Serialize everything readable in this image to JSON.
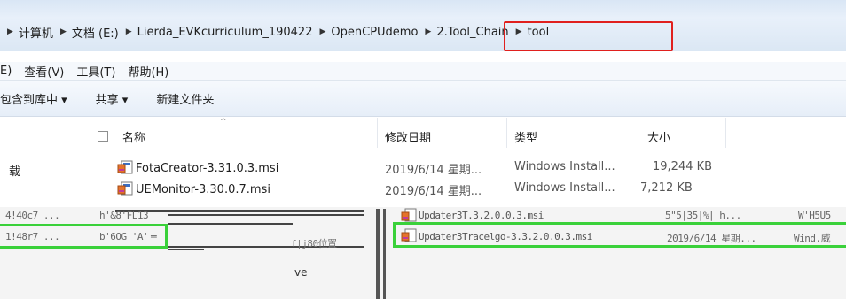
{
  "address_bar": {
    "crumbs": [
      "计算机",
      "文档 (E:)",
      "Lierda_EVKcurriculum_190422",
      "OpenCPUdemo",
      "2.Tool_Chain",
      "tool"
    ]
  },
  "menu": {
    "items": [
      "E)",
      "查看(V)",
      "工具(T)",
      "帮助(H)"
    ]
  },
  "toolbar": {
    "include_library": "包含到库中 ▾",
    "share": "共享 ▾",
    "new_folder": "新建文件夹"
  },
  "nav": {
    "item_download": "载"
  },
  "columns": {
    "name": "名称",
    "modified": "修改日期",
    "type": "类型",
    "size": "大小"
  },
  "files": [
    {
      "name": "FotaCreator-3.31.0.3.msi",
      "modified": "2019/6/14 星期...",
      "type": "Windows Install...",
      "size": "19,244 KB"
    },
    {
      "name": "UEMonitor-3.30.0.7.msi",
      "modified": "2019/6/14 星期...",
      "type": "Windows Install...",
      "size": "7,212 KB"
    }
  ],
  "glitch": {
    "text_ve": "ve",
    "left_row1_a": "4!40c7 ...",
    "left_row1_b": "h'&8'FL13",
    "left_row2_a": "1!48r7 ...",
    "left_row2_b": "b'6OG 'A'",
    "mid_label": "f|j80位置",
    "right_row1": "Updater3T.3.2.0.0.3.msi",
    "right_row1_tail": "5\"5|35|%| h...",
    "right_row1_end": "W'H5U5",
    "right_row2": "Updater3Tracelgo-3.3.2.0.0.3.msi",
    "right_row2_mid": "2019/6/14 星期...",
    "right_row2_end": "Wind.威"
  },
  "colors": {
    "highlight_red": "#e0201e",
    "highlight_green": "#3ad13a"
  }
}
